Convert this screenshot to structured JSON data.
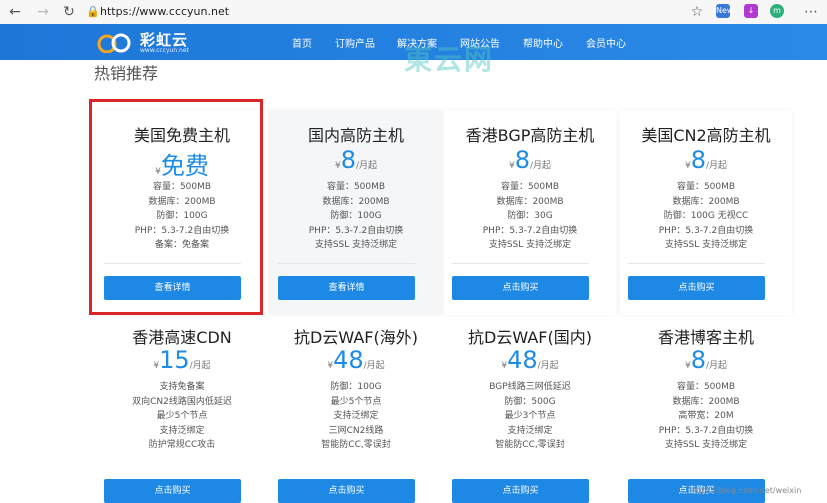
{
  "browser": {
    "url": "https://www.cccyun.net",
    "ext_new": "New",
    "ext_m": "m"
  },
  "site": {
    "brand": "彩虹云",
    "brand_sub": "www.cccyun.net",
    "watermark": "東云网",
    "nav": [
      "首页",
      "订购产品",
      "解决方案",
      "网站公告",
      "帮助中心",
      "会员中心"
    ]
  },
  "section": {
    "title": "热销推荐",
    "currency": "¥",
    "unit": "/月起"
  },
  "cards_top": [
    {
      "name": "美国免费主机",
      "price": "免费",
      "show_unit": false,
      "features": [
        "容量：500MB",
        "数据库：200MB",
        "防御：100G",
        "PHP：5.3-7.2自由切换",
        "备案：免备案"
      ],
      "button": "查看详情"
    },
    {
      "name": "国内高防主机",
      "price": "8",
      "show_unit": true,
      "features": [
        "容量：500MB",
        "数据库：200MB",
        "防御：100G",
        "PHP：5.3-7.2自由切换",
        "支持SSL 支持泛绑定"
      ],
      "button": "查看详情"
    },
    {
      "name": "香港BGP高防主机",
      "price": "8",
      "show_unit": true,
      "features": [
        "容量：500MB",
        "数据库：200MB",
        "防御：30G",
        "PHP：5.3-7.2自由切换",
        "支持SSL 支持泛绑定"
      ],
      "button": "点击购买"
    },
    {
      "name": "美国CN2高防主机",
      "price": "8",
      "show_unit": true,
      "features": [
        "容量：500MB",
        "数据库：200MB",
        "防御：100G 无视CC",
        "PHP：5.3-7.2自由切换",
        "支持SSL 支持泛绑定"
      ],
      "button": "点击购买"
    }
  ],
  "cards_bottom": [
    {
      "name": "香港高速CDN",
      "price": "15",
      "features": [
        "支持免备案",
        "双向CN2线路国内低延迟",
        "最少5个节点",
        "支持泛绑定",
        "防护常规CC攻击"
      ],
      "button": "点击购买"
    },
    {
      "name": "抗D云WAF(海外)",
      "price": "48",
      "features": [
        "防御：100G",
        "最少5个节点",
        "支持泛绑定",
        "三网CN2线路",
        "智能防CC,零误封"
      ],
      "button": "点击购买"
    },
    {
      "name": "抗D云WAF(国内)",
      "price": "48",
      "features": [
        "BGP线路三网低延迟",
        "防御：500G",
        "最少3个节点",
        "支持泛绑定",
        "智能防CC,零误封"
      ],
      "button": "点击购买"
    },
    {
      "name": "香港博客主机",
      "price": "8",
      "features": [
        "容量：500MB",
        "数据库：200MB",
        "高带宽：20M",
        "PHP：5.3-7.2自由切换",
        "支持SSL 支持泛绑定"
      ],
      "button": "点击购买"
    }
  ],
  "footer_watermark": "https://blog.csdn.net/weixin"
}
